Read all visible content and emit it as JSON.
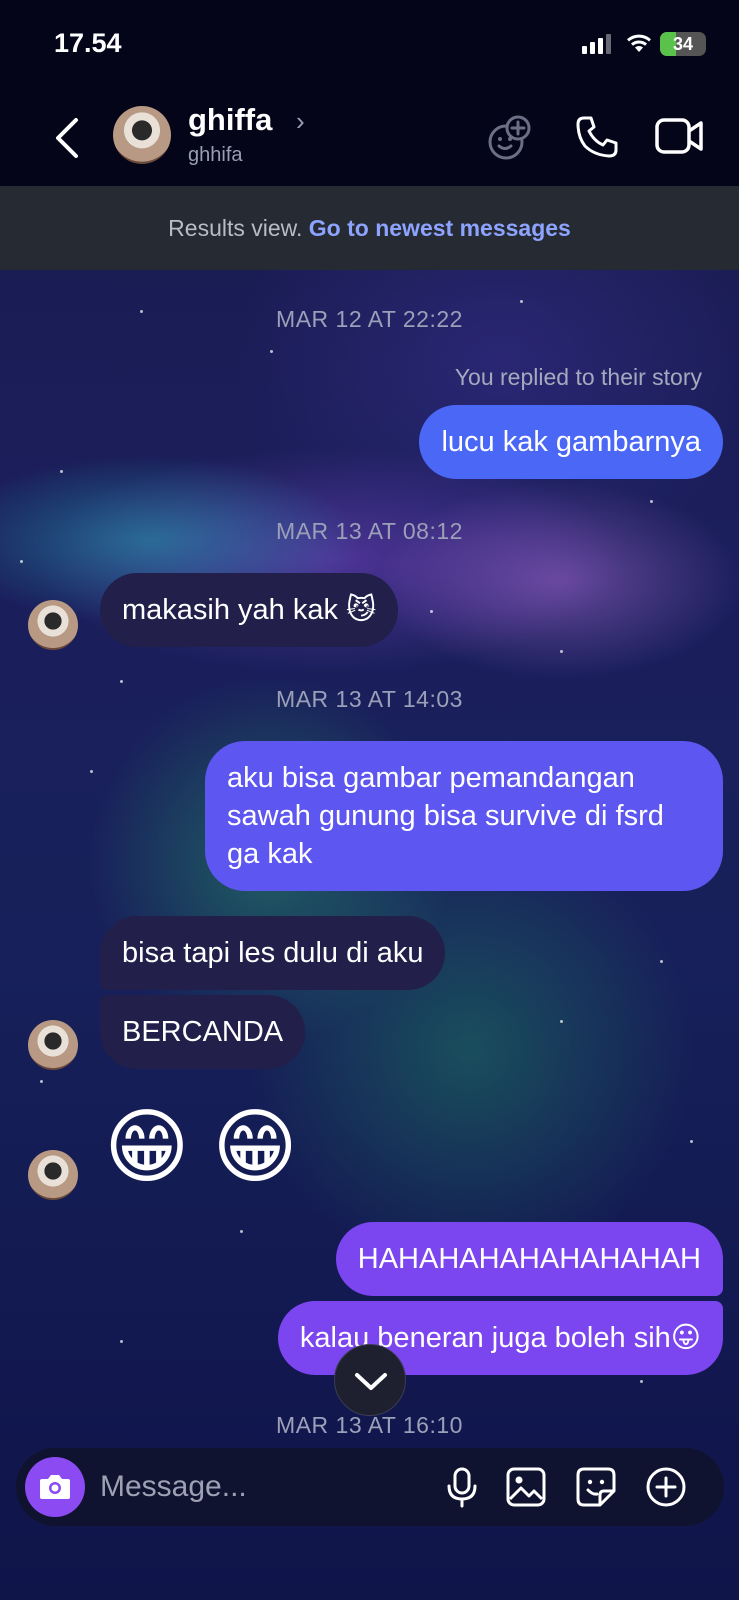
{
  "status_bar": {
    "time": "17.54",
    "battery": "34",
    "battery_level": 0.34
  },
  "header": {
    "name": "ghiffa",
    "username": "ghhifa",
    "icons": [
      "back-icon",
      "avatar",
      "effects-icon",
      "phone-icon",
      "video-icon"
    ]
  },
  "banner": {
    "text": "Results view.",
    "link": "Go to newest messages"
  },
  "conversation": {
    "ts_1": "MAR 12 AT 22:22",
    "reply_note": "You replied to their story",
    "msg_1": "lucu kak gambarnya",
    "ts_2": "MAR 13 AT 08:12",
    "msg_2": "makasih yah kak 😼",
    "ts_3": "MAR 13 AT 14:03",
    "msg_3": "aku bisa gambar pemandangan sawah gunung bisa survive di fsrd ga kak",
    "msg_4": "bisa tapi les dulu di aku",
    "msg_5": "BERCANDA",
    "msg_6": "😁 😁",
    "msg_7": "HAHAHAHAHAHAHAHAH",
    "msg_8": "kalau beneran juga boleh sih😛",
    "ts_4": "MAR 13 AT 16:10"
  },
  "composer": {
    "placeholder": "Message..."
  },
  "colors": {
    "outgoing_blue": "#4a67f5",
    "outgoing_indigo": "#5d56f0",
    "outgoing_purple": "#7b45f0",
    "incoming": "#221f4a",
    "camera_button": "#8c4bf2",
    "link": "#8da4ff"
  }
}
